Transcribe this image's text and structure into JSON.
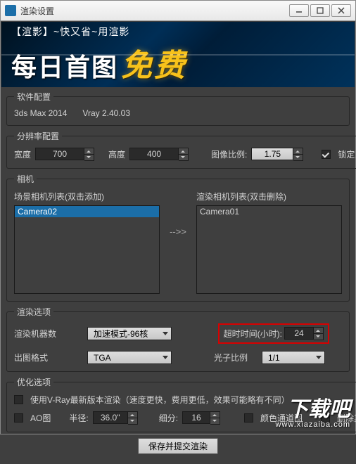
{
  "window": {
    "title": "渲染设置",
    "minimize": "minimize",
    "maximize": "maximize",
    "close": "close"
  },
  "banner": {
    "line1": "【渲影】~快又省~用渲影",
    "text_white": "每日首图",
    "text_yellow": "免费"
  },
  "software": {
    "legend": "软件配置",
    "app": "3ds Max 2014",
    "renderer": "Vray 2.40.03"
  },
  "resolution": {
    "legend": "分辨率配置",
    "width_label": "宽度",
    "width_value": "700",
    "height_label": "高度",
    "height_value": "400",
    "ratio_label": "图像比例:",
    "ratio_value": "1.75",
    "lock_checked": true,
    "lock_label": "锁定比例"
  },
  "camera": {
    "legend": "相机",
    "scene_label": "场景相机列表(双击添加)",
    "render_label": "渲染相机列表(双击删除)",
    "scene_items": [
      "Camera02"
    ],
    "render_items": [
      "Camera01"
    ],
    "arrow": "-->>"
  },
  "render_options": {
    "legend": "渲染选项",
    "machines_label": "渲染机器数",
    "machines_value": "加速模式-96核",
    "timeout_label": "超时时间(小时):",
    "timeout_value": "24",
    "format_label": "出图格式",
    "format_value": "TGA",
    "photon_label": "光子比例",
    "photon_value": "1/1"
  },
  "optimize": {
    "legend": "优化选项",
    "use_vray_label": "使用V-Ray最新版本渲染（速度更快，费用更低，效果可能略有不同）",
    "ao_label": "AO图",
    "radius_label": "半径:",
    "radius_value": "36.0\"",
    "subdiv_label": "细分:",
    "subdiv_value": "16",
    "color_channel_label": "颜色通道图",
    "del_other_label": "删除其它通道"
  },
  "submit_label": "保存并提交渲染",
  "watermark": {
    "big": "下载吧",
    "url": "www.xiazaiba.com"
  }
}
